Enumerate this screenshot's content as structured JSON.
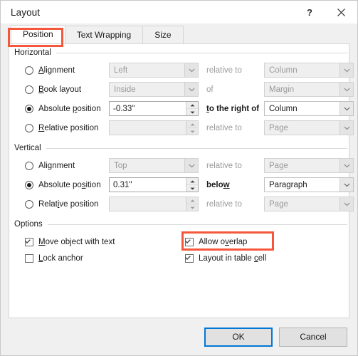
{
  "window": {
    "title": "Layout",
    "help_icon": "question-mark-icon",
    "help_label": "?",
    "close_icon": "close-icon"
  },
  "accent": {
    "highlight_red": "#f4573b",
    "focus_blue": "#0078d7"
  },
  "tabs": [
    {
      "label": "Position",
      "active": true,
      "highlighted": true
    },
    {
      "label": "Text Wrapping",
      "active": false,
      "highlighted": false
    },
    {
      "label": "Size",
      "active": false,
      "highlighted": false
    }
  ],
  "horizontal": {
    "group_label": "Horizontal",
    "rows": [
      {
        "radio_label": "Alignment",
        "mnemonic": "A",
        "selected": false,
        "control_type": "combo",
        "control_value": "Left",
        "control_disabled": true,
        "mid_label": "relative to",
        "mid_label_enabled": false,
        "mid_mnemonic": "",
        "right_value": "Column",
        "right_disabled": true
      },
      {
        "radio_label": "Book layout",
        "mnemonic": "B",
        "selected": false,
        "control_type": "combo",
        "control_value": "Inside",
        "control_disabled": true,
        "mid_label": "of",
        "mid_label_enabled": false,
        "mid_mnemonic": "",
        "right_value": "Margin",
        "right_disabled": true
      },
      {
        "radio_label": "Absolute position",
        "mnemonic": "p",
        "selected": true,
        "control_type": "spinner",
        "control_value": "-0.33\"",
        "control_disabled": false,
        "mid_label": "to the right of",
        "mid_label_enabled": true,
        "mid_mnemonic": "t",
        "right_value": "Column",
        "right_disabled": false
      },
      {
        "radio_label": "Relative position",
        "mnemonic": "R",
        "selected": false,
        "control_type": "spinner",
        "control_value": "",
        "control_disabled": true,
        "mid_label": "relative to",
        "mid_label_enabled": false,
        "mid_mnemonic": "",
        "right_value": "Page",
        "right_disabled": true
      }
    ]
  },
  "vertical": {
    "group_label": "Vertical",
    "rows": [
      {
        "radio_label": "Alignment",
        "mnemonic": "g",
        "selected": false,
        "control_type": "combo",
        "control_value": "Top",
        "control_disabled": true,
        "mid_label": "relative to",
        "mid_label_enabled": false,
        "mid_mnemonic": "",
        "right_value": "Page",
        "right_disabled": true
      },
      {
        "radio_label": "Absolute position",
        "mnemonic": "s",
        "selected": true,
        "control_type": "spinner",
        "control_value": "0.31\"",
        "control_disabled": false,
        "mid_label": "below",
        "mid_label_enabled": true,
        "mid_mnemonic": "w",
        "right_value": "Paragraph",
        "right_disabled": false
      },
      {
        "radio_label": "Relative position",
        "mnemonic": "i",
        "selected": false,
        "control_type": "spinner",
        "control_value": "",
        "control_disabled": true,
        "mid_label": "relative to",
        "mid_label_enabled": false,
        "mid_mnemonic": "",
        "right_value": "Page",
        "right_disabled": true
      }
    ]
  },
  "options": {
    "group_label": "Options",
    "items": [
      {
        "label": "Move object with text",
        "mnemonic": "M",
        "checked": true,
        "highlighted": false,
        "column": "left"
      },
      {
        "label": "Lock anchor",
        "mnemonic": "L",
        "checked": false,
        "highlighted": false,
        "column": "left"
      },
      {
        "label": "Allow overlap",
        "mnemonic": "v",
        "checked": true,
        "highlighted": true,
        "column": "right"
      },
      {
        "label": "Layout in table cell",
        "mnemonic": "c",
        "checked": true,
        "highlighted": false,
        "column": "right"
      }
    ]
  },
  "footer": {
    "ok_label": "OK",
    "cancel_label": "Cancel",
    "default_button": "OK"
  }
}
